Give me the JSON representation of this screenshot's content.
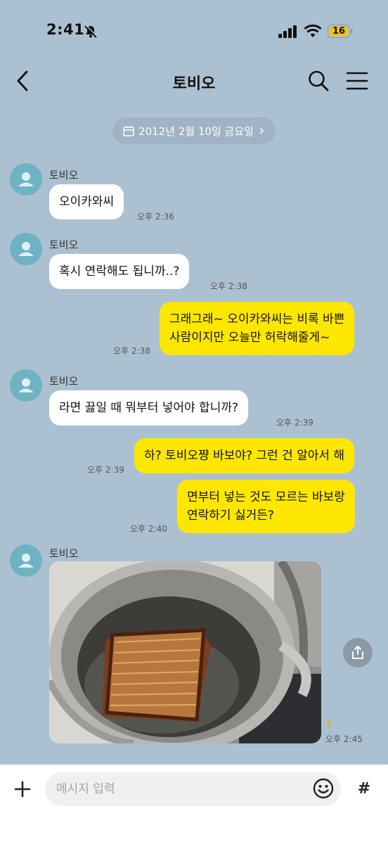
{
  "status": {
    "time": "2:41",
    "battery": "16",
    "icons": [
      "bell-slash-icon",
      "cellular-signal-icon",
      "wifi-icon",
      "battery-icon"
    ]
  },
  "header": {
    "title": "토비오",
    "icons": [
      "back-chevron-icon",
      "search-icon",
      "hamburger-menu-icon"
    ]
  },
  "date_divider": "2012년 2월 10일 금요일",
  "messages": [
    {
      "sender": "토비오",
      "text": "오이카와씨",
      "time": "오후 2:36"
    },
    {
      "sender": "토비오",
      "text": "혹시 연락해도 됩니까..?",
      "time": "오후 2:38"
    },
    {
      "line1": "그래그래~ 오이카와씨는 비록 바쁜",
      "line2": "사람이지만 오늘만 허락해줄게~",
      "time": "오후 2:38"
    },
    {
      "sender": "토비오",
      "text": "라면 끓일 때 뭐부터 넣어야 합니까?",
      "time": "오후 2:39"
    },
    {
      "text": "하? 토비오쨩 바보야? 그런 건 알아서 해",
      "time": "오후 2:39"
    },
    {
      "line1": "면부터 넣는 것도 모르는 바보랑",
      "line2": "연락하기 싫거든?",
      "time": "오후 2:40"
    },
    {
      "sender": "토비오",
      "time": "오후 2:45",
      "unread": "1"
    }
  ],
  "composer": {
    "placeholder": "메시지 입력",
    "hash": "#"
  },
  "colors": {
    "background": "#abc1d1",
    "outgoing_bubble": "#fde700",
    "incoming_bubble": "#ffffff",
    "avatar": "#6fb2c4"
  }
}
